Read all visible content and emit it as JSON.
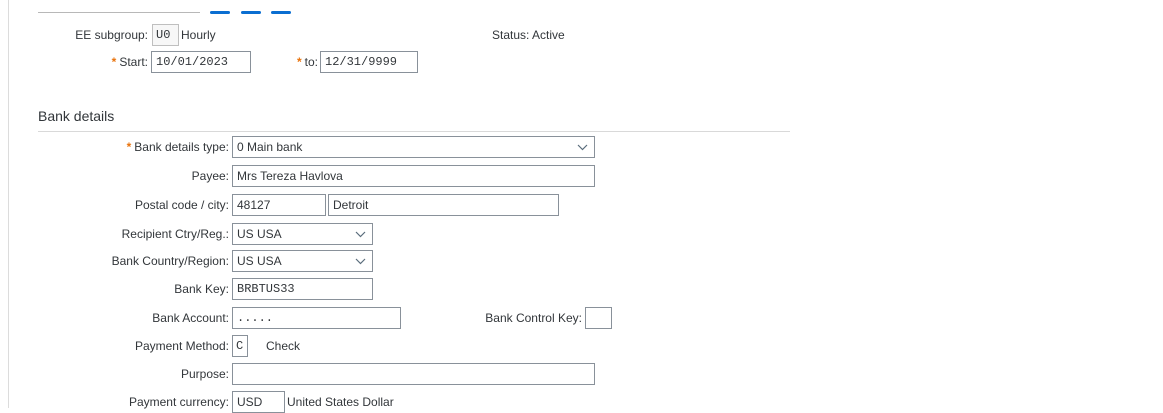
{
  "header": {
    "ee_subgroup_label": "EE subgroup:",
    "ee_subgroup_code": "U0",
    "ee_subgroup_text": "Hourly",
    "status_label": "Status:",
    "status_value": "Active",
    "start_label": "Start:",
    "start_value": "10/01/2023",
    "to_label": "to:",
    "to_value": "12/31/9999"
  },
  "bank": {
    "section_title": "Bank details",
    "details_type_label": "Bank details type:",
    "details_type_value": "0 Main bank",
    "payee_label": "Payee:",
    "payee_value": "Mrs Tereza Havlova",
    "postal_city_label": "Postal code / city:",
    "postal_code": "48127",
    "city": "Detroit",
    "recipient_country_label": "Recipient Ctry/Reg.:",
    "recipient_country_value": "US USA",
    "bank_country_label": "Bank Country/Region:",
    "bank_country_value": "US USA",
    "bank_key_label": "Bank Key:",
    "bank_key_value": "BRBTUS33",
    "bank_account_label": "Bank Account:",
    "bank_account_value": ".....",
    "control_key_label": "Bank Control Key:",
    "control_key_value": "",
    "payment_method_label": "Payment Method:",
    "payment_method_code": "C",
    "payment_method_text": "Check",
    "purpose_label": "Purpose:",
    "purpose_value": "",
    "currency_label": "Payment currency:",
    "currency_code": "USD",
    "currency_text": "United States Dollar"
  },
  "icons": {
    "dropdown": "chevron-down-icon"
  },
  "colors": {
    "required": "#e9730c",
    "tab_accent": "#0a6ed1",
    "field_border": "#89919a"
  }
}
